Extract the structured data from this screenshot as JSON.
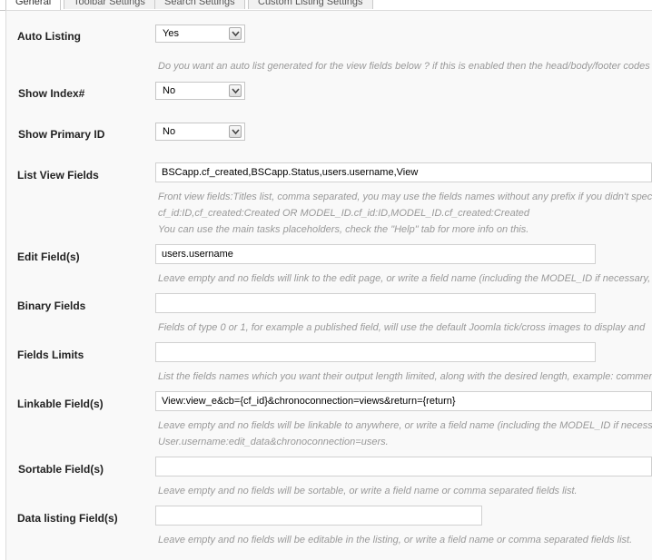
{
  "tabs": [
    {
      "label": "General"
    },
    {
      "label": "Toolbar Settings"
    },
    {
      "label": "Search Settings"
    },
    {
      "label": "Custom Listing Settings"
    }
  ],
  "fields": {
    "auto_listing": {
      "label": "Auto Listing",
      "value": "Yes",
      "hint": "Do you want an auto list generated for the view fields below ? if this is enabled then the head/body/footer codes"
    },
    "show_index": {
      "label": "Show Index#",
      "value": "No"
    },
    "show_primary_id": {
      "label": "Show Primary ID",
      "value": "No"
    },
    "list_view_fields": {
      "label": "List View Fields",
      "value": "BSCapp.cf_created,BSCapp.Status,users.username,View",
      "hint1": "Front view fields:Titles list, comma separated, you may use the fields names without any prefix if you didn't spec",
      "hint2": "cf_id:ID,cf_created:Created OR MODEL_ID.cf_id:ID,MODEL_ID.cf_created:Created",
      "hint3": "You can use the main tasks placeholders, check the \"Help\" tab for more info on this."
    },
    "edit_fields": {
      "label": "Edit Field(s)",
      "value": "users.username",
      "hint": "Leave empty and no fields will link to the edit page, or write a field name (including the MODEL_ID if necessary,"
    },
    "binary_fields": {
      "label": "Binary Fields",
      "value": "",
      "hint": "Fields of type 0 or 1, for example a published field, will use the default Joomla tick/cross images to display and"
    },
    "fields_limits": {
      "label": "Fields Limits",
      "value": "",
      "hint": "List the fields names which you want their output length limited, along with the desired length, example: commen"
    },
    "linkable_fields": {
      "label": "Linkable Field(s)",
      "value": "View:view_e&cb={cf_id}&chronoconnection=views&return={return}",
      "hint1": "Leave empty and no fields will be linkable to anywhere, or write a field name (including the MODEL_ID if necess",
      "hint2": "User.username:edit_data&chronoconnection=users."
    },
    "sortable_fields": {
      "label": "Sortable Field(s)",
      "value": "",
      "hint": "Leave empty and no fields will be sortable, or write a field name or comma separated fields list."
    },
    "data_listing_fields": {
      "label": "Data listing Field(s)",
      "value": "",
      "hint": "Leave empty and no fields will be editable in the listing, or write a field name or comma separated fields list."
    }
  },
  "icons": {
    "dropdown": "chevron-down-icon"
  }
}
